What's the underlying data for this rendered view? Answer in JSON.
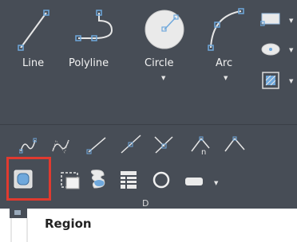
{
  "ribbon": {
    "draw_tools": [
      {
        "label": "Line",
        "icon": "line-icon"
      },
      {
        "label": "Polyline",
        "icon": "polyline-icon"
      },
      {
        "label": "Circle",
        "icon": "circle-icon"
      },
      {
        "label": "Arc",
        "icon": "arc-icon"
      }
    ],
    "side_tools": [
      "rectangle-icon",
      "point-icon",
      "hatch-icon"
    ],
    "modify_row1": [
      "spline-fit-icon",
      "spline-cv-icon",
      "ray-icon",
      "construction-line-icon",
      "xline-icon",
      "multiline-icon",
      "multiline-alt-icon"
    ],
    "modify_row2": [
      "region-icon",
      "wipeout-icon",
      "revision-cloud-icon",
      "table-icon",
      "donut-icon",
      "dropdown-more-icon"
    ],
    "panel_partial": "D"
  },
  "tooltip": {
    "title": "Region"
  },
  "colors": {
    "ribbon_bg": "#474d56",
    "highlight": "#e03a2f",
    "icon_blue": "#6fa8dc",
    "tooltip_bg": "#ffffff"
  }
}
